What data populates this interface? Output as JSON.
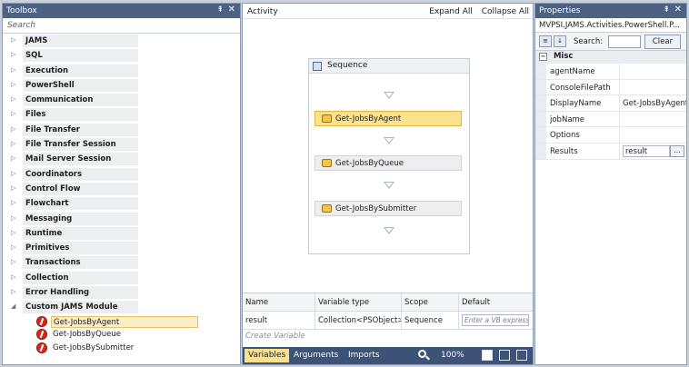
{
  "toolbox": {
    "title": "Toolbox",
    "pin": "⇞",
    "close": "✕",
    "search_placeholder": "Search",
    "categories": [
      {
        "label": "JAMS"
      },
      {
        "label": "SQL"
      },
      {
        "label": "Execution"
      },
      {
        "label": "PowerShell"
      },
      {
        "label": "Communication"
      },
      {
        "label": "Files"
      },
      {
        "label": "File Transfer"
      },
      {
        "label": "File Transfer Session"
      },
      {
        "label": "Mail Server Session"
      },
      {
        "label": "Coordinators"
      },
      {
        "label": "Control Flow"
      },
      {
        "label": "Flowchart"
      },
      {
        "label": "Messaging"
      },
      {
        "label": "Runtime"
      },
      {
        "label": "Primitives"
      },
      {
        "label": "Transactions"
      },
      {
        "label": "Collection"
      },
      {
        "label": "Error Handling"
      },
      {
        "label": "Custom JAMS Module"
      }
    ],
    "expanded_items": [
      {
        "label": "Get-JobsByAgent"
      },
      {
        "label": "Get-JobsByQueue"
      },
      {
        "label": "Get-JobsBySubmitter"
      }
    ]
  },
  "designer": {
    "title": "Activity",
    "expand_all": "Expand All",
    "collapse_all": "Collapse All",
    "sequence_label": "Sequence",
    "activities": [
      {
        "label": "Get-JobsByAgent"
      },
      {
        "label": "Get-JobsByQueue"
      },
      {
        "label": "Get-JobsBySubmitter"
      }
    ],
    "variables": {
      "headers": [
        "Name",
        "Variable type",
        "Scope",
        "Default"
      ],
      "row": {
        "name": "result",
        "type": "Collection<PSObject>",
        "scope": "Sequence",
        "default_placeholder": "Enter a VB expression"
      },
      "create": "Create Variable"
    },
    "footer": {
      "tabs": [
        "Variables",
        "Arguments",
        "Imports"
      ],
      "zoom": "100%"
    }
  },
  "properties": {
    "title": "Properties",
    "pin": "⇞",
    "close": "✕",
    "object": "MVPSI.JAMS.Activities.PowerShell.P...",
    "search_label": "Search:",
    "clear_label": "Clear",
    "category": "Misc",
    "rows": [
      {
        "name": "agentName",
        "value": ""
      },
      {
        "name": "ConsoleFilePath",
        "value": ""
      },
      {
        "name": "DisplayName",
        "value": "Get-JobsByAgent"
      },
      {
        "name": "jobName",
        "value": ""
      },
      {
        "name": "Options",
        "value": ""
      },
      {
        "name": "Results",
        "value": "result"
      }
    ],
    "ellipsis": "..."
  },
  "colors": {
    "title_bar": "#4d6183",
    "selection": "#fbe28c",
    "footer": "#3d5277"
  }
}
